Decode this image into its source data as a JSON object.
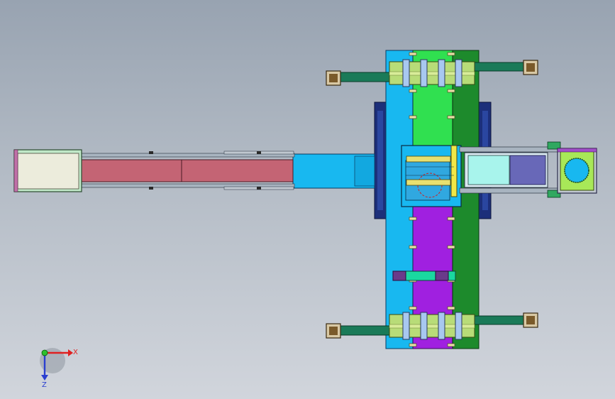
{
  "triad": {
    "x_label": "X",
    "z_label": "Z",
    "x_color": "#e02020",
    "z_color": "#2a3fd0",
    "origin_color": "#2ec02e"
  },
  "palette": {
    "background_top": "#98a3b1",
    "background_bottom": "#d1d5dc",
    "cyan_plate": "#18b8f0",
    "green_plate": "#30e050",
    "dark_green_plate": "#1d8a2c",
    "purple_plate": "#a020e0",
    "rose_slide": "#c46474",
    "cream_head": "#ececdc",
    "navy_side": "#1c2f7a",
    "khaki_clamp": "#b8dc78",
    "teal_arm": "#1a7a58",
    "tan_pad": "#d8c8a4",
    "lavender_block": "#6868b8",
    "mint_block": "#a8f4ec"
  }
}
